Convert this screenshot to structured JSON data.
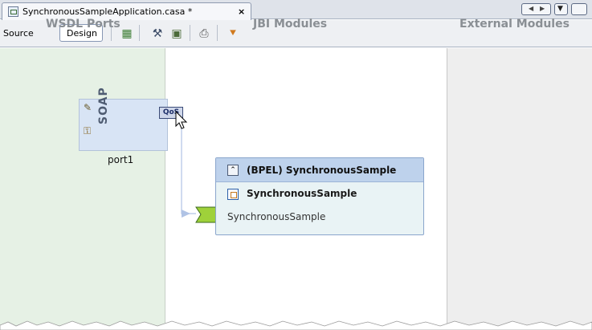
{
  "tab": {
    "title": "SynchronousSampleApplication.casa *",
    "close_glyph": "×"
  },
  "toolbar": {
    "source_label": "Source",
    "design_label": "Design"
  },
  "regions": {
    "wsdl_ports": "WSDL Ports",
    "jbi_modules": "JBI Modules",
    "external_modules": "External Modules"
  },
  "soap_port": {
    "label": "SOAP",
    "caption": "port1",
    "qos_label": "QoS"
  },
  "bpel_module": {
    "title": "(BPEL) SynchronousSample",
    "process": "SynchronousSample",
    "endpoint": "SynchronousSample"
  },
  "colors": {
    "wsdl_region": "#e6f1e5",
    "jbi_region": "#ffffff",
    "external_region": "#eeeeee",
    "consumer_endpoint": "#c7a6e6",
    "provider_endpoint": "#9fd13a"
  }
}
